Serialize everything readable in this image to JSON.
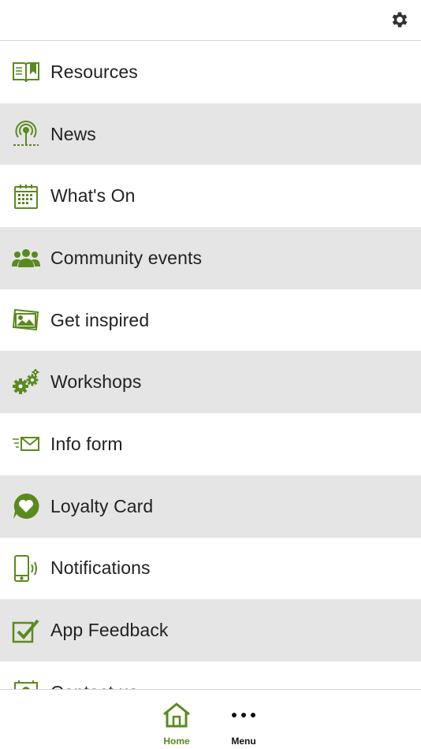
{
  "colors": {
    "accent": "#5a8a1f",
    "row_alt": "#e5e5e5",
    "text": "#222222"
  },
  "header": {
    "settings_icon": "gear-icon"
  },
  "menu": {
    "items": [
      {
        "label": "Resources",
        "icon": "book-icon"
      },
      {
        "label": "News",
        "icon": "broadcast-icon"
      },
      {
        "label": "What's On",
        "icon": "calendar-icon"
      },
      {
        "label": "Community events",
        "icon": "people-icon"
      },
      {
        "label": "Get inspired",
        "icon": "photos-icon"
      },
      {
        "label": "Workshops",
        "icon": "gears-icon"
      },
      {
        "label": "Info form",
        "icon": "envelope-icon"
      },
      {
        "label": "Loyalty Card",
        "icon": "heart-bubble-icon"
      },
      {
        "label": "Notifications",
        "icon": "phone-icon"
      },
      {
        "label": "App Feedback",
        "icon": "checkbox-icon"
      },
      {
        "label": "Contact us",
        "icon": "contact-icon"
      }
    ]
  },
  "tabbar": {
    "home_label": "Home",
    "menu_label": "Menu"
  }
}
